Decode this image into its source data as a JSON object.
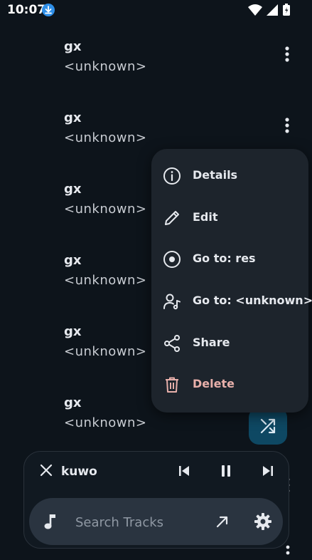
{
  "status_bar": {
    "time": "10:07"
  },
  "tracks": [
    {
      "title": "gx",
      "artist": "<unknown>"
    },
    {
      "title": "gx",
      "artist": "<unknown>"
    },
    {
      "title": "gx",
      "artist": "<unknown>"
    },
    {
      "title": "gx",
      "artist": "<unknown>"
    },
    {
      "title": "gx",
      "artist": "<unknown>"
    },
    {
      "title": "gx",
      "artist": "<unknown>"
    }
  ],
  "context_menu": {
    "items": [
      {
        "label": "Details",
        "icon": "info-icon"
      },
      {
        "label": "Edit",
        "icon": "pencil-icon"
      },
      {
        "label": "Go to: res",
        "icon": "album-icon"
      },
      {
        "label": "Go to: <unknown>",
        "icon": "artist-icon"
      },
      {
        "label": "Share",
        "icon": "share-icon"
      },
      {
        "label": "Delete",
        "icon": "trash-icon"
      }
    ]
  },
  "player": {
    "now_playing": "kuwo"
  },
  "search": {
    "placeholder": "Search Tracks"
  },
  "colors": {
    "background": "#0d141b",
    "menu_background": "#1d242c",
    "fab_background": "#0e4863",
    "delete_text": "#e8b0ab",
    "search_background": "#2a3440"
  }
}
